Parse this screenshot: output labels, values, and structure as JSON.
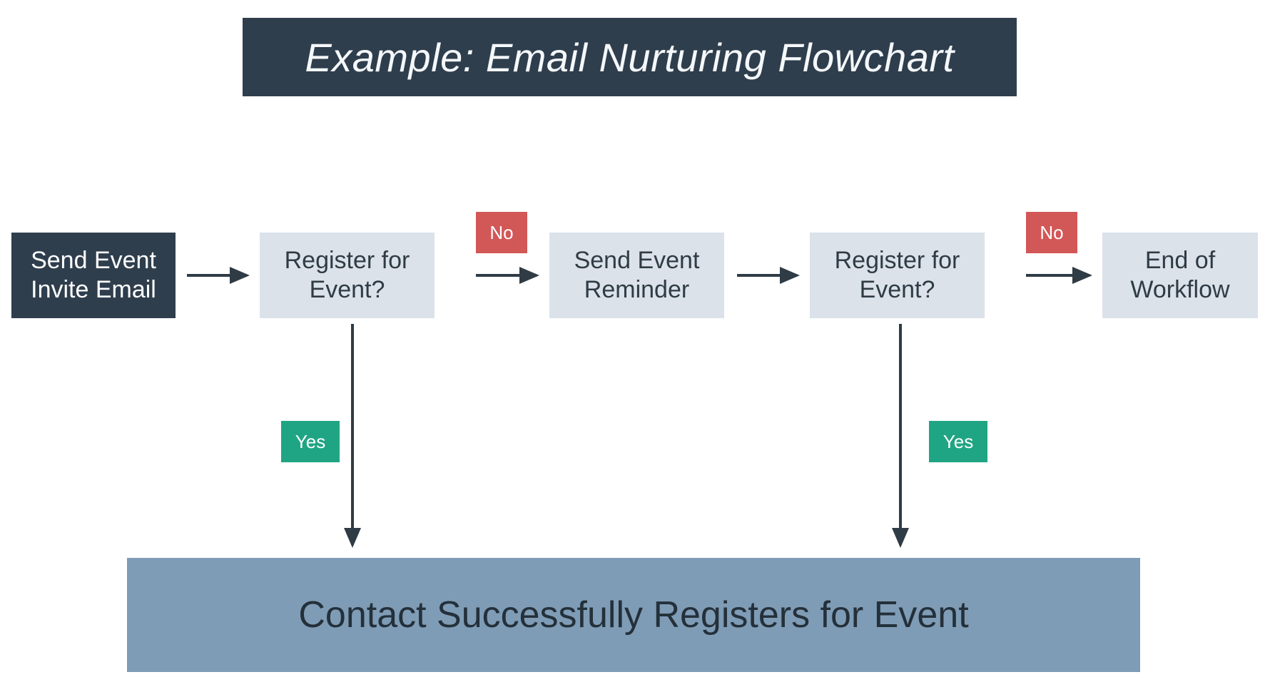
{
  "title": "Example: Email Nurturing Flowchart",
  "nodes": {
    "send_invite": "Send Event Invite Email",
    "register1": "Register for Event?",
    "reminder": "Send Event Reminder",
    "register2": "Register for Event?",
    "end": "End of Workflow"
  },
  "tags": {
    "no1": "No",
    "no2": "No",
    "yes1": "Yes",
    "yes2": "Yes"
  },
  "result": "Contact Successfully Registers for Event",
  "colors": {
    "dark": "#2f3e4d",
    "light": "#dbe2ea",
    "result": "#7f9cb6",
    "no": "#d25757",
    "yes": "#1fa583",
    "arrow": "#2f3b45"
  }
}
